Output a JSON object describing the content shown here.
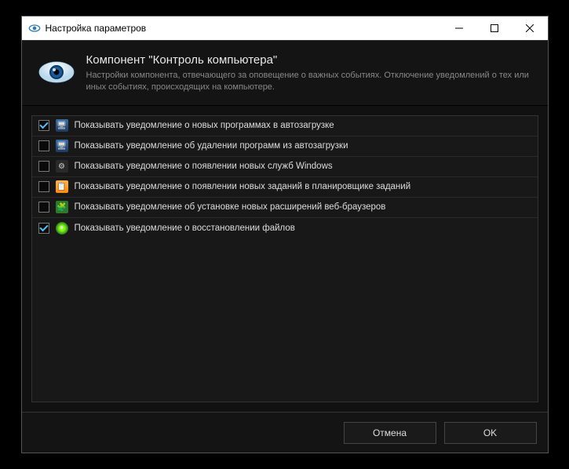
{
  "window": {
    "title": "Настройка параметров"
  },
  "header": {
    "heading": "Компонент \"Контроль компьютера\"",
    "subheading": "Настройки компонента, отвечающего за оповещение о важных событиях. Отключение уведомлений о тех или иных событиях, происходящих на компьютере."
  },
  "options": [
    {
      "checked": true,
      "icon": "ic-autoload",
      "iconName": "program-add-icon",
      "label": "Показывать уведомление о новых программах в автозагрузке"
    },
    {
      "checked": false,
      "icon": "ic-autoload2",
      "iconName": "program-remove-icon",
      "label": "Показывать уведомление об удалении программ из автозагрузки"
    },
    {
      "checked": false,
      "icon": "ic-gear",
      "iconName": "service-icon",
      "label": "Показывать уведомление о появлении новых служб Windows"
    },
    {
      "checked": false,
      "icon": "ic-task",
      "iconName": "scheduler-icon",
      "label": "Показывать уведомление о появлении новых заданий в планировщике заданий"
    },
    {
      "checked": false,
      "icon": "ic-puzzle",
      "iconName": "extension-icon",
      "label": "Показывать уведомление об установке новых расширений веб-браузеров"
    },
    {
      "checked": true,
      "icon": "ic-restore",
      "iconName": "restore-icon",
      "label": "Показывать уведомление о восстановлении файлов"
    }
  ],
  "footer": {
    "cancel": "Отмена",
    "ok": "OK"
  }
}
